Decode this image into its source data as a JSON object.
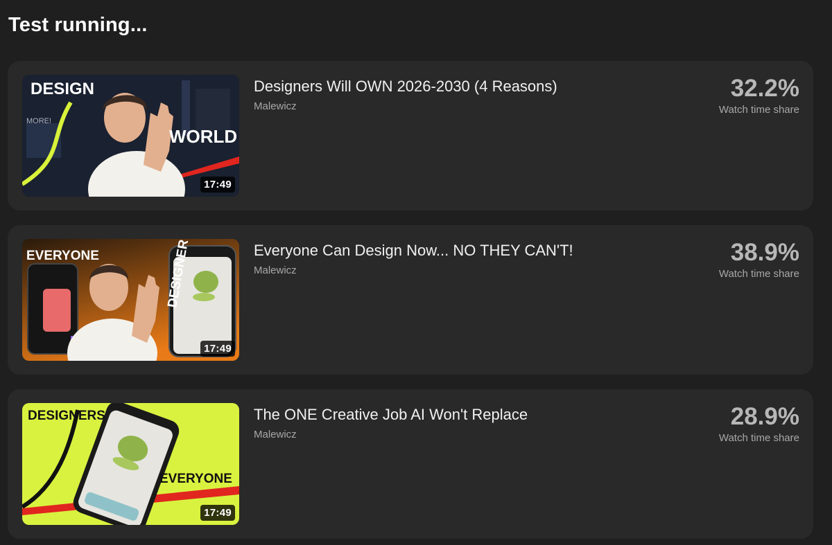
{
  "header": {
    "title": "Test running..."
  },
  "variants": [
    {
      "title": "Designers Will OWN 2026-2030 (4 Reasons)",
      "channel": "Malewicz",
      "duration": "17:49",
      "share": "32.2%",
      "share_label": "Watch time share",
      "thumb_text": [
        "DESIGN",
        "WORLD",
        "MORE!"
      ]
    },
    {
      "title": "Everyone Can Design Now... NO THEY CAN'T!",
      "channel": "Malewicz",
      "duration": "17:49",
      "share": "38.9%",
      "share_label": "Watch time share",
      "thumb_text": [
        "EVERYONE",
        "DESIGNER"
      ]
    },
    {
      "title": "The ONE Creative Job AI Won't Replace",
      "channel": "Malewicz",
      "duration": "17:49",
      "share": "28.9%",
      "share_label": "Watch time share",
      "thumb_text": [
        "DESIGNERS",
        "EVERYONE"
      ]
    }
  ]
}
